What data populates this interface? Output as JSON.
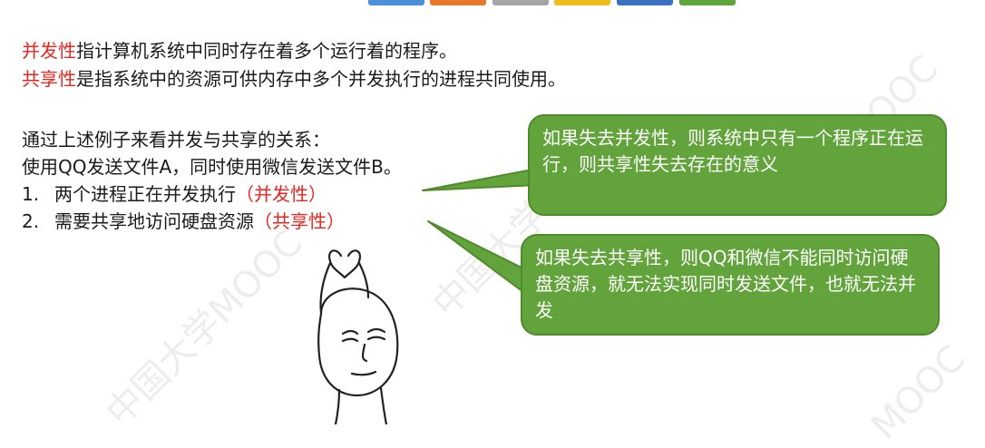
{
  "top_bar_colors": [
    "#4a90d9",
    "#e8792b",
    "#a5a5a5",
    "#f2bb1d",
    "#3b6fc2",
    "#5ea53a"
  ],
  "line1": {
    "term": "并发性",
    "rest": "指计算机系统中同时存在着多个运行着的程序。"
  },
  "line2": {
    "term": "共享性",
    "rest": "是指系统中的资源可供内存中多个并发执行的进程共同使用。"
  },
  "relation_intro": "通过上述例子来看并发与共享的关系：",
  "example": "使用QQ发送文件A，同时使用微信发送文件B。",
  "points": [
    {
      "num": "1.",
      "text": "两个进程正在并发执行",
      "tag": "（并发性）"
    },
    {
      "num": "2.",
      "text": "需要共享地访问硬盘资源",
      "tag": "（共享性）"
    }
  ],
  "callout_concurrency": "如果失去并发性，则系统中只有一个程序正在运行，则共享性失去存在的意义",
  "callout_sharing": "如果失去共享性，则QQ和微信不能同时访问硬盘资源，就无法实现同时发送文件，也就无法并发",
  "watermarks": [
    "中国大学MOOC",
    "中国大学MOOC",
    "MOOC",
    "MOOC"
  ],
  "colors": {
    "term_red": "#e8261f",
    "callout_green": "#62a33c",
    "callout_border": "#4f8a2c"
  }
}
